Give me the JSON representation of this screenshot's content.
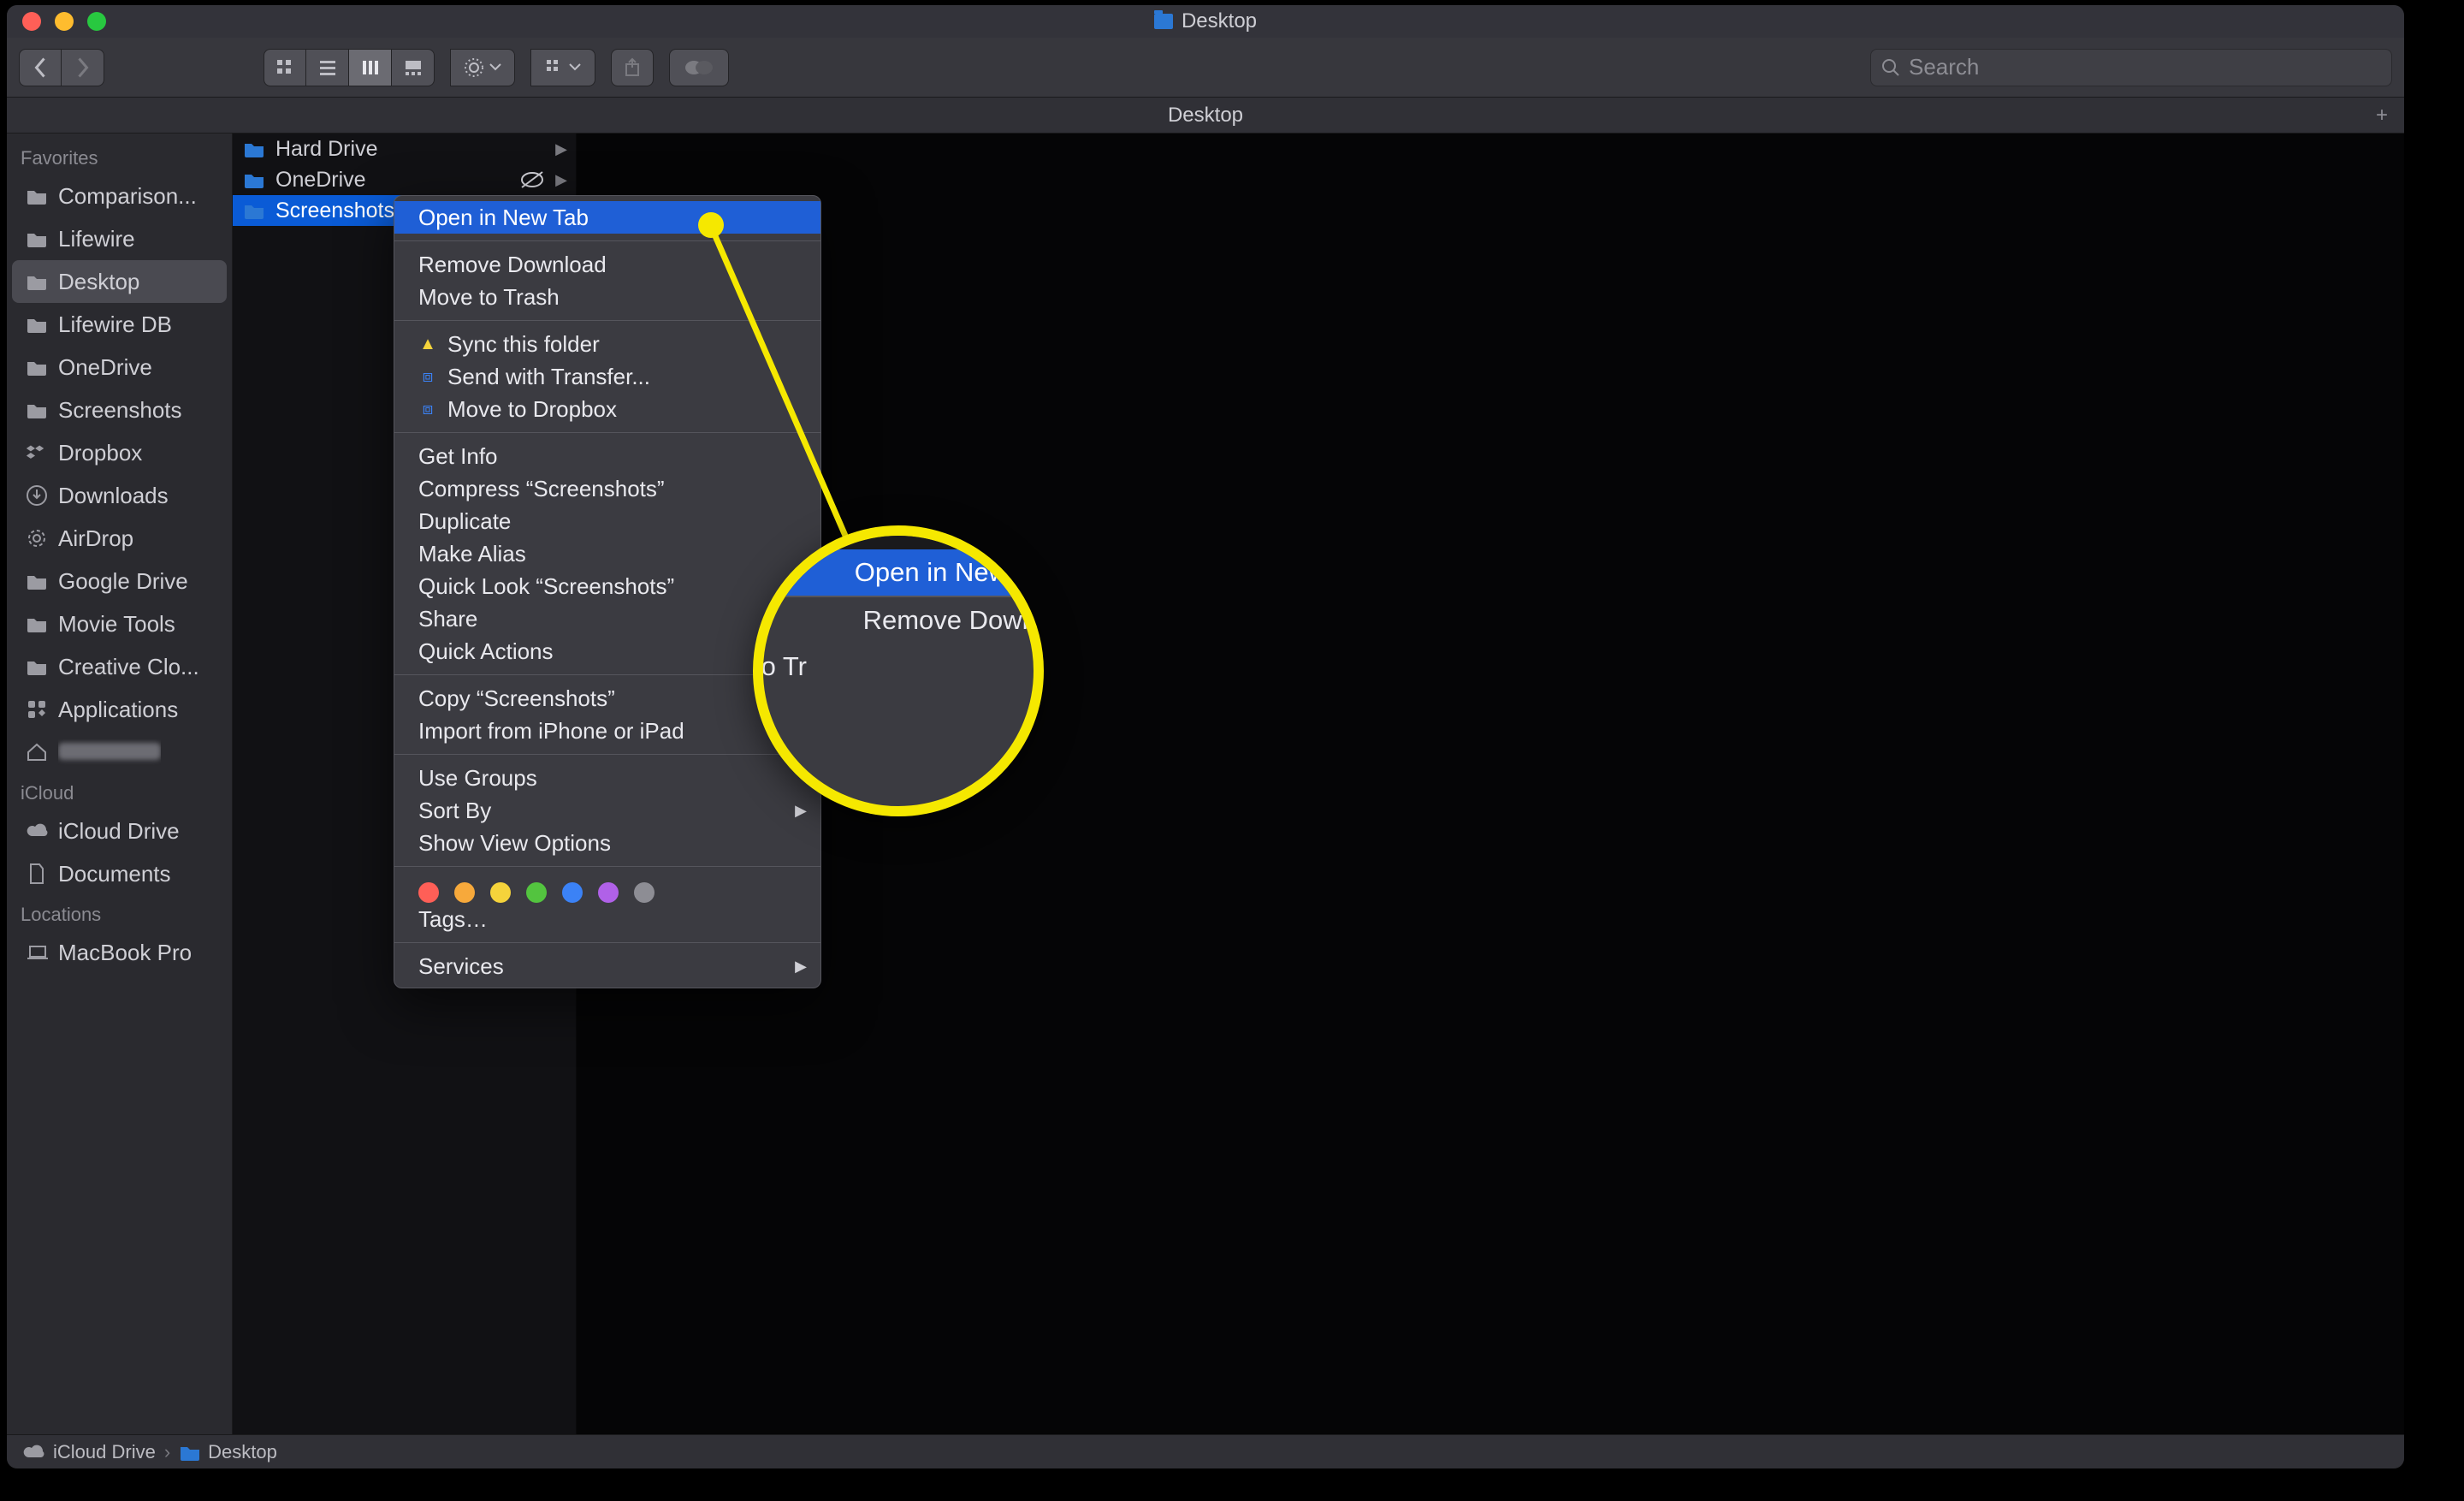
{
  "window": {
    "title": "Desktop"
  },
  "tabbar": {
    "active_tab": "Desktop",
    "add_label": "+"
  },
  "toolbar": {
    "search_placeholder": "Search"
  },
  "sidebar": {
    "sections": [
      {
        "label": "Favorites",
        "items": [
          {
            "label": "Comparison...",
            "icon": "folder"
          },
          {
            "label": "Lifewire",
            "icon": "folder"
          },
          {
            "label": "Desktop",
            "icon": "folder",
            "selected": true
          },
          {
            "label": "Lifewire DB",
            "icon": "folder"
          },
          {
            "label": "OneDrive",
            "icon": "folder"
          },
          {
            "label": "Screenshots",
            "icon": "folder"
          },
          {
            "label": "Dropbox",
            "icon": "dropbox"
          },
          {
            "label": "Downloads",
            "icon": "downloads"
          },
          {
            "label": "AirDrop",
            "icon": "airdrop"
          },
          {
            "label": "Google Drive",
            "icon": "folder"
          },
          {
            "label": "Movie Tools",
            "icon": "folder"
          },
          {
            "label": "Creative Clo...",
            "icon": "folder"
          },
          {
            "label": "Applications",
            "icon": "apps"
          },
          {
            "label": "",
            "icon": "home",
            "blurred": true
          }
        ]
      },
      {
        "label": "iCloud",
        "items": [
          {
            "label": "iCloud Drive",
            "icon": "cloud"
          },
          {
            "label": "Documents",
            "icon": "doc"
          }
        ]
      },
      {
        "label": "Locations",
        "items": [
          {
            "label": "MacBook Pro",
            "icon": "laptop"
          }
        ]
      }
    ]
  },
  "column1": {
    "items": [
      {
        "label": "Hard Drive",
        "icon": "folder",
        "chevron": true
      },
      {
        "label": "OneDrive",
        "icon": "folder",
        "chevron": true,
        "sync_off": true
      },
      {
        "label": "Screenshots",
        "icon": "folder",
        "selected": true
      }
    ]
  },
  "context_menu": {
    "groups": [
      [
        {
          "label": "Open in New Tab",
          "highlighted": true
        }
      ],
      [
        {
          "label": "Remove Download"
        },
        {
          "label": "Move to Trash"
        }
      ],
      [
        {
          "label": "Sync this folder",
          "icon": "gdrive"
        },
        {
          "label": "Send with Transfer...",
          "icon": "dropbox"
        },
        {
          "label": "Move to Dropbox",
          "icon": "dropbox"
        }
      ],
      [
        {
          "label": "Get Info"
        },
        {
          "label": "Compress “Screenshots”"
        },
        {
          "label": "Duplicate"
        },
        {
          "label": "Make Alias"
        },
        {
          "label": "Quick Look “Screenshots”"
        },
        {
          "label": "Share",
          "submenu": true
        },
        {
          "label": "Quick Actions",
          "submenu": true
        }
      ],
      [
        {
          "label": "Copy “Screenshots”"
        },
        {
          "label": "Import from iPhone or iPad",
          "submenu": true
        }
      ],
      [
        {
          "label": "Use Groups"
        },
        {
          "label": "Sort By",
          "submenu": true
        },
        {
          "label": "Show View Options"
        }
      ]
    ],
    "tags_colors": [
      "#ff5f57",
      "#f7a93b",
      "#f5d33b",
      "#53c43f",
      "#3b82f6",
      "#b061e8",
      "#8d8d94"
    ],
    "tags_label": "Tags…",
    "services": {
      "label": "Services",
      "submenu": true
    }
  },
  "magnifier": {
    "line1": "Open in New Tab",
    "line2": "Remove Downlo",
    "line3": "to Tr"
  },
  "pathbar": {
    "crumbs": [
      {
        "label": "iCloud Drive",
        "icon": "cloud"
      },
      {
        "label": "Desktop",
        "icon": "folder"
      }
    ]
  }
}
